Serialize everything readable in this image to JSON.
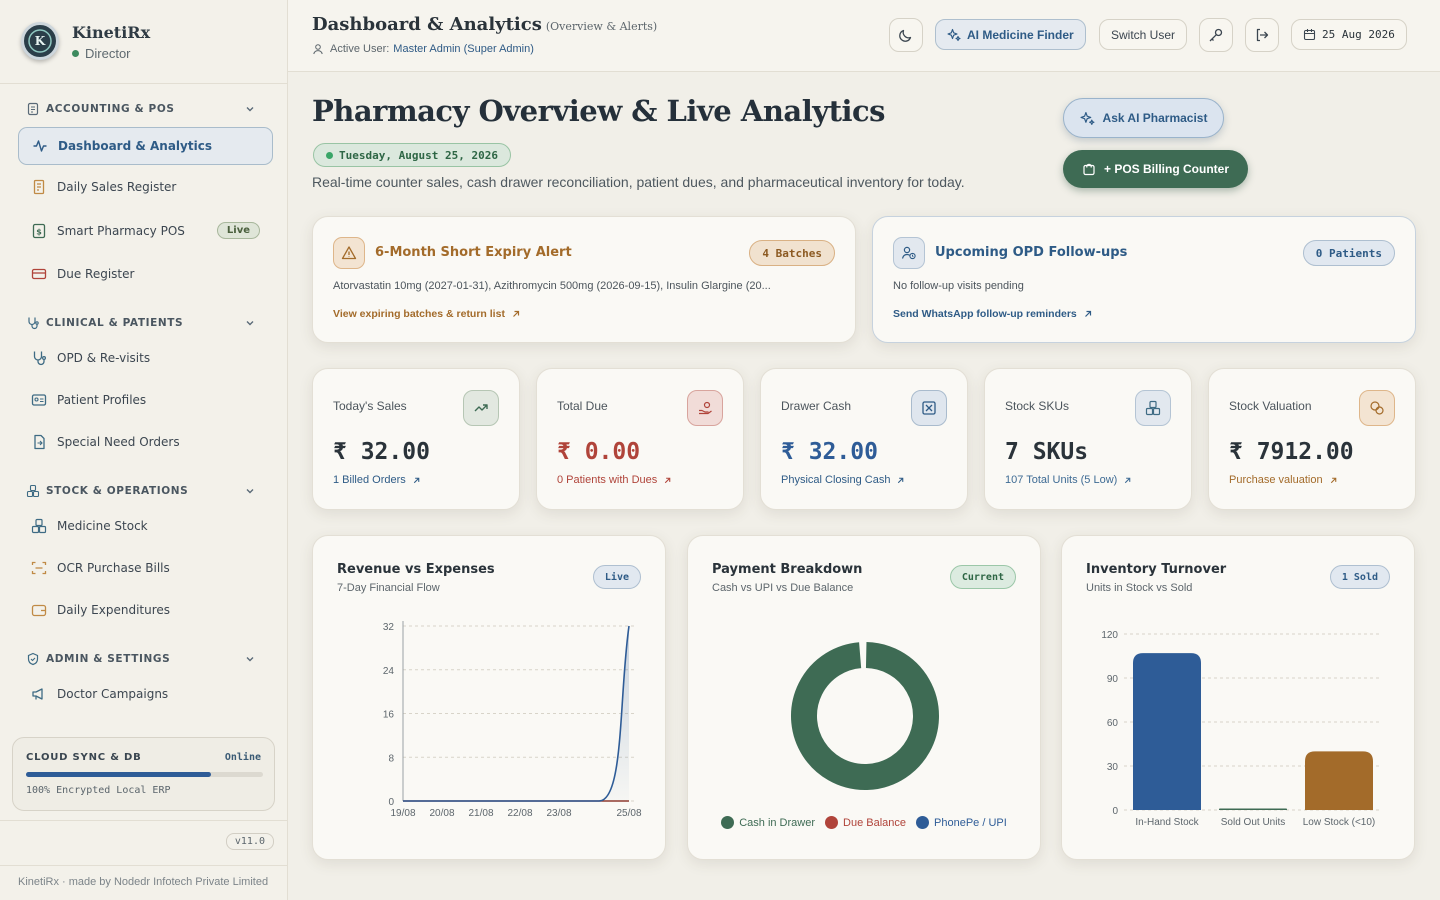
{
  "app": {
    "name": "KinetiRx",
    "role": "Director"
  },
  "sidebar": {
    "sections": [
      {
        "title": "ACCOUNTING & POS"
      },
      {
        "title": "CLINICAL & PATIENTS"
      },
      {
        "title": "STOCK & OPERATIONS"
      },
      {
        "title": "ADMIN & SETTINGS"
      }
    ],
    "items": [
      {
        "label": "Dashboard & Analytics"
      },
      {
        "label": "Daily Sales Register"
      },
      {
        "label": "Smart Pharmacy POS",
        "badge": "Live"
      },
      {
        "label": "Due Register"
      },
      {
        "label": "OPD & Re-visits"
      },
      {
        "label": "Patient Profiles"
      },
      {
        "label": "Special Need Orders"
      },
      {
        "label": "Medicine Stock"
      },
      {
        "label": "OCR Purchase Bills"
      },
      {
        "label": "Daily Expenditures"
      },
      {
        "label": "Doctor Campaigns"
      }
    ],
    "sync": {
      "title": "CLOUD SYNC & DB",
      "status": "Online",
      "progress": 0.78,
      "detail": "100% Encrypted Local ERP"
    },
    "version": "v11.0",
    "credit": "KinetiRx · made by Nodedr Infotech Private Limited"
  },
  "header": {
    "title": "Dashboard & Analytics",
    "subtitle": "(Overview & Alerts)",
    "user_label": "Active User:",
    "user_value": "Master Admin (Super Admin)",
    "ai_finder": "AI Medicine Finder",
    "switch_user": "Switch User",
    "date": "25 Aug 2026"
  },
  "main": {
    "title": "Pharmacy Overview & Live Analytics",
    "date_pill": "Tuesday, August 25, 2026",
    "lead": "Real-time counter sales, cash drawer reconciliation, patient dues, and pharmaceutical inventory for today.",
    "ask_ai": "Ask AI Pharmacist",
    "pos": "+ POS Billing Counter"
  },
  "alerts": [
    {
      "title": "6-Month Short Expiry Alert",
      "badge": "4 Batches",
      "text": "Atorvastatin 10mg (2027-01-31), Azithromycin 500mg (2026-09-15), Insulin Glargine (20...",
      "link": "View expiring batches & return list"
    },
    {
      "title": "Upcoming OPD Follow-ups",
      "badge": "0 Patients",
      "text": "No follow-up visits pending",
      "link": "Send WhatsApp follow-up reminders"
    }
  ],
  "stats": [
    {
      "label": "Today's Sales",
      "value": "₹ 32.00",
      "sub": "1 Billed Orders",
      "icon": "trend-up-icon"
    },
    {
      "label": "Total Due",
      "value": "₹ 0.00",
      "sub": "0 Patients with Dues",
      "icon": "hand-coins-icon"
    },
    {
      "label": "Drawer Cash",
      "value": "₹ 32.00",
      "sub": "Physical Closing Cash",
      "icon": "cash-box-icon"
    },
    {
      "label": "Stock SKUs",
      "value": "7 SKUs",
      "sub": "107 Total Units (5 Low)",
      "icon": "boxes-icon"
    },
    {
      "label": "Stock Valuation",
      "value": "₹ 7912.00",
      "sub": "Purchase valuation",
      "icon": "coins-icon"
    }
  ],
  "colors": {
    "accent": "#2e5b86",
    "green": "#3e6b54",
    "amber": "#a36b2a",
    "red": "#b0443a",
    "blue": "#2e5c97"
  },
  "charts": [
    {
      "title": "Revenue vs Expenses",
      "subtitle": "7-Day Financial Flow",
      "badge": "Live"
    },
    {
      "title": "Payment Breakdown",
      "subtitle": "Cash vs UPI vs Due Balance",
      "badge": "Current"
    },
    {
      "title": "Inventory Turnover",
      "subtitle": "Units in Stock vs Sold",
      "badge": "1 Sold"
    }
  ],
  "chart_data": [
    {
      "type": "line",
      "x": [
        "19/08",
        "20/08",
        "21/08",
        "22/08",
        "23/08",
        "25/08"
      ],
      "series": [
        {
          "values": [
            0,
            0,
            0,
            0,
            0,
            32
          ]
        },
        {
          "values": [
            0,
            0,
            0,
            0,
            0,
            0
          ]
        }
      ],
      "ylim": [
        0,
        32
      ],
      "yticks": [
        0,
        8,
        16,
        24,
        32
      ],
      "grid": true
    },
    {
      "type": "pie",
      "labels": [
        "Cash in Drawer",
        "Due Balance",
        "PhonePe / UPI"
      ],
      "values": [
        32,
        0,
        0
      ],
      "colors": [
        "#3e6b54",
        "#b0443a",
        "#2e5c97"
      ],
      "legend": "bottom"
    },
    {
      "type": "bar",
      "categories": [
        "In-Hand Stock",
        "Sold Out Units",
        "Low Stock (<10)"
      ],
      "values": [
        107,
        1,
        40
      ],
      "colors": [
        "#2e5c97",
        "#3e6b54",
        "#a36b2a"
      ],
      "ylim": [
        0,
        120
      ],
      "yticks": [
        0,
        30,
        60,
        90,
        120
      ],
      "grid": true
    }
  ]
}
